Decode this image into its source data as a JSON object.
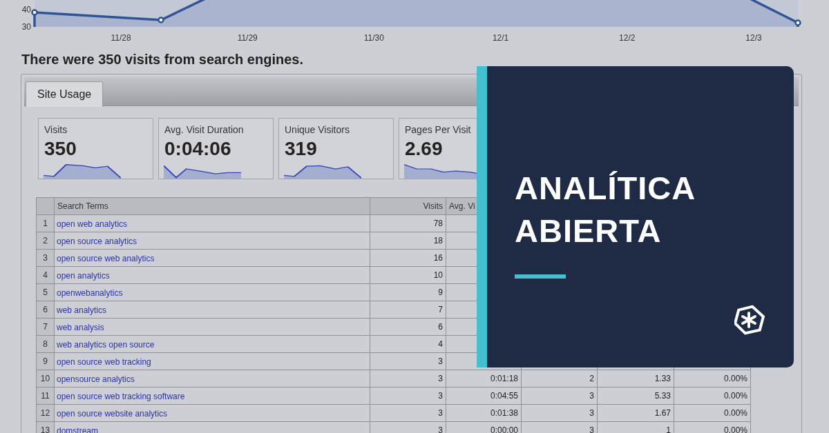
{
  "chart": {
    "y_axis_labels": [
      "40",
      "30"
    ],
    "x_axis_labels": [
      "11/28",
      "11/29",
      "11/30",
      "12/1",
      "12/2",
      "12/3"
    ]
  },
  "summary": "There were 350 visits from search engines.",
  "tabs": [
    {
      "label": "Site Usage",
      "selected": true
    }
  ],
  "metrics": [
    {
      "label": "Visits",
      "value": "350"
    },
    {
      "label": "Avg. Visit Duration",
      "value": "0:04:06"
    },
    {
      "label": "Unique Visitors",
      "value": "319"
    },
    {
      "label": "Pages Per Visit",
      "value": "2.69"
    }
  ],
  "table": {
    "columns": [
      "Search Terms",
      "Visits",
      "Avg. Vi"
    ],
    "rows": [
      {
        "index": "1",
        "term": "open web analytics",
        "visits": "78"
      },
      {
        "index": "2",
        "term": "open source analytics",
        "visits": "18"
      },
      {
        "index": "3",
        "term": "open source web analytics",
        "visits": "16"
      },
      {
        "index": "4",
        "term": "open analytics",
        "visits": "10"
      },
      {
        "index": "5",
        "term": "openwebanalytics",
        "visits": "9"
      },
      {
        "index": "6",
        "term": "web analytics",
        "visits": "7"
      },
      {
        "index": "7",
        "term": "web analysis",
        "visits": "6"
      },
      {
        "index": "8",
        "term": "web analytics open source",
        "visits": "4"
      },
      {
        "index": "9",
        "term": "open source web tracking",
        "visits": "3"
      },
      {
        "index": "10",
        "term": "opensource analytics",
        "visits": "3",
        "duration": "0:01:18",
        "unique": "2",
        "pages": "1.33",
        "bounce": "0.00%"
      },
      {
        "index": "11",
        "term": "open source web tracking software",
        "visits": "3",
        "duration": "0:04:55",
        "unique": "3",
        "pages": "5.33",
        "bounce": "0.00%"
      },
      {
        "index": "12",
        "term": "open source website analytics",
        "visits": "3",
        "duration": "0:01:38",
        "unique": "3",
        "pages": "1.67",
        "bounce": "0.00%"
      },
      {
        "index": "13",
        "term": "domstream",
        "visits": "3",
        "duration": "0:00:00",
        "unique": "3",
        "pages": "1",
        "bounce": "0.00%"
      }
    ]
  },
  "overlay": {
    "title_lines": [
      "ANALÍTICA",
      "ABIERTA"
    ]
  }
}
